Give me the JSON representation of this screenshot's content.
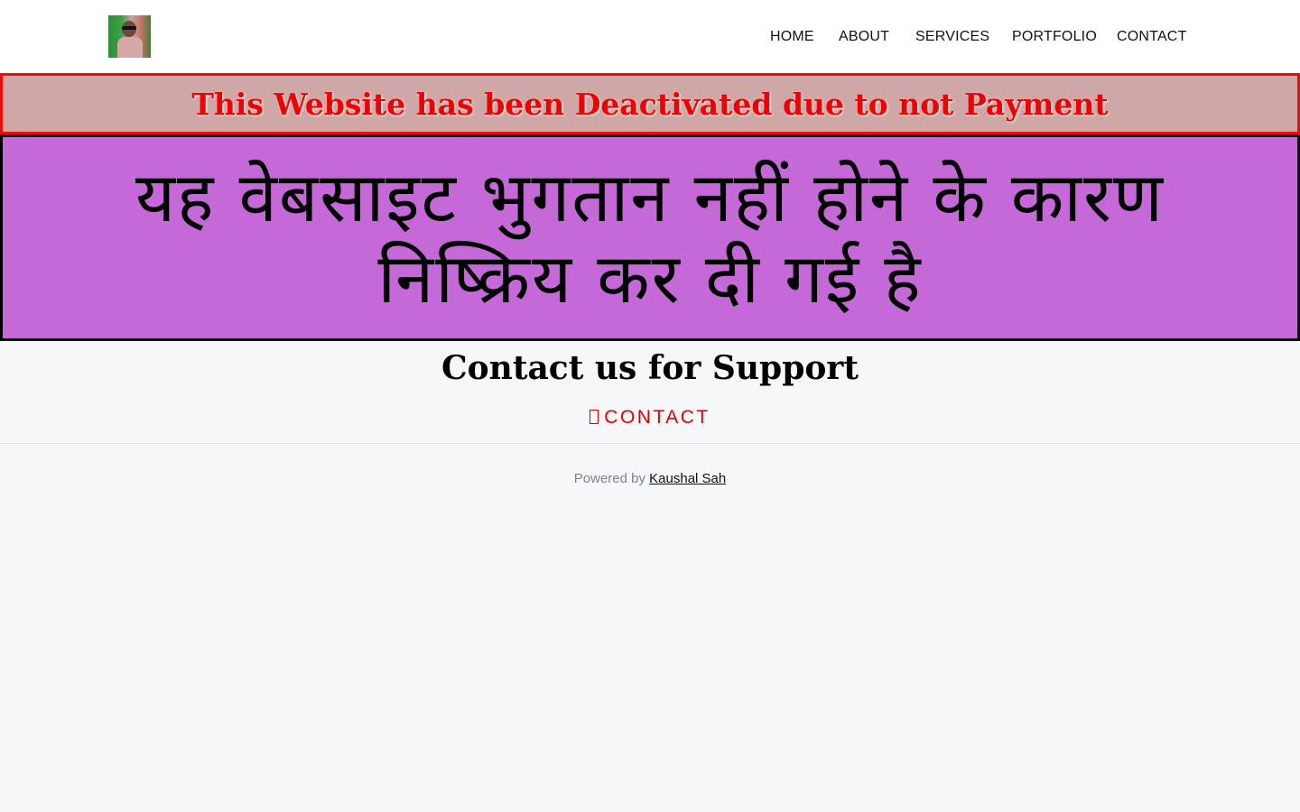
{
  "header": {
    "logo_alt": "",
    "nav": [
      {
        "label": "HOME"
      },
      {
        "label": "ABOUT"
      },
      {
        "label": "SERVICES"
      },
      {
        "label": "PORTFOLIO"
      },
      {
        "label": "CONTACT"
      }
    ]
  },
  "notice": {
    "english": "This Website has been Deactivated due to not Payment",
    "native": "यह वेबसाइट भुगतान नहीं होने के कारण निष्क्रिय कर दी गई है"
  },
  "support": {
    "heading": "Contact us for Support",
    "contact_label": "CONTACT",
    "contact_icon": "phone-icon"
  },
  "footer": {
    "powered_by": "Powered by",
    "author": "Kaushal Sah"
  },
  "colors": {
    "banner_red_bg": "#cfa7a7",
    "banner_red_border": "#ee0b0b",
    "banner_red_text": "#f00000",
    "banner_purple_bg": "#c569d9",
    "contact_link": "#e00000",
    "page_bg": "#f5f7f9"
  }
}
